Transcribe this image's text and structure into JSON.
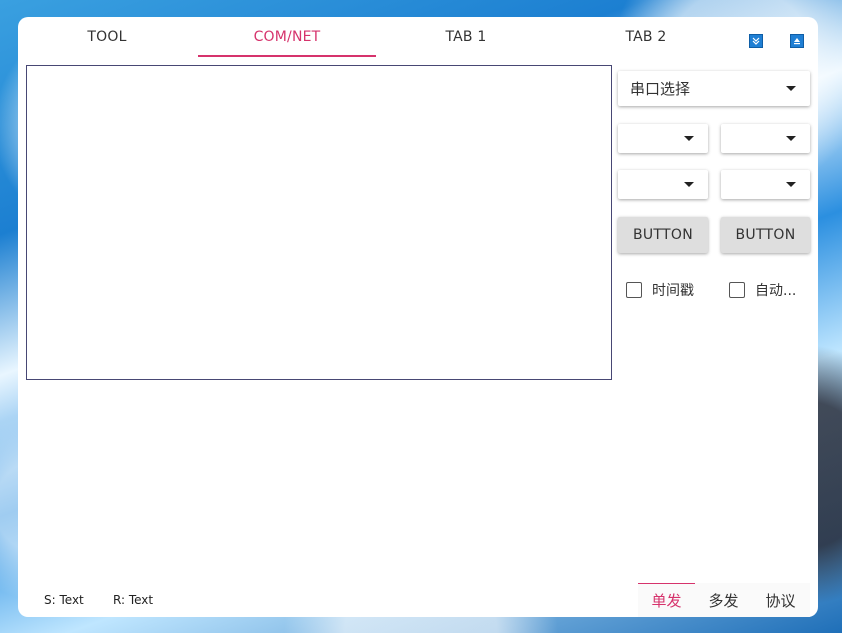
{
  "tabs": [
    {
      "label": "TOOL"
    },
    {
      "label": "COM/NET"
    },
    {
      "label": "TAB 1"
    },
    {
      "label": "TAB 2"
    }
  ],
  "active_tab": "COM/NET",
  "serial": {
    "port_select_label": "串口选择",
    "select_a": "",
    "select_b": "",
    "select_c": "",
    "select_d": ""
  },
  "buttons": {
    "button_1": "BUTTON",
    "button_2": "BUTTON"
  },
  "checkboxes": {
    "timestamp": "时间戳",
    "auto": "自动..."
  },
  "status": {
    "send": "S:  Text",
    "receive": "R:  Text"
  },
  "bottom_tabs": [
    {
      "label": "单发"
    },
    {
      "label": "多发"
    },
    {
      "label": "协议"
    }
  ],
  "colors": {
    "accent": "#d6336c",
    "window_button": "#1f7fd4",
    "textarea_border": "#474774"
  }
}
